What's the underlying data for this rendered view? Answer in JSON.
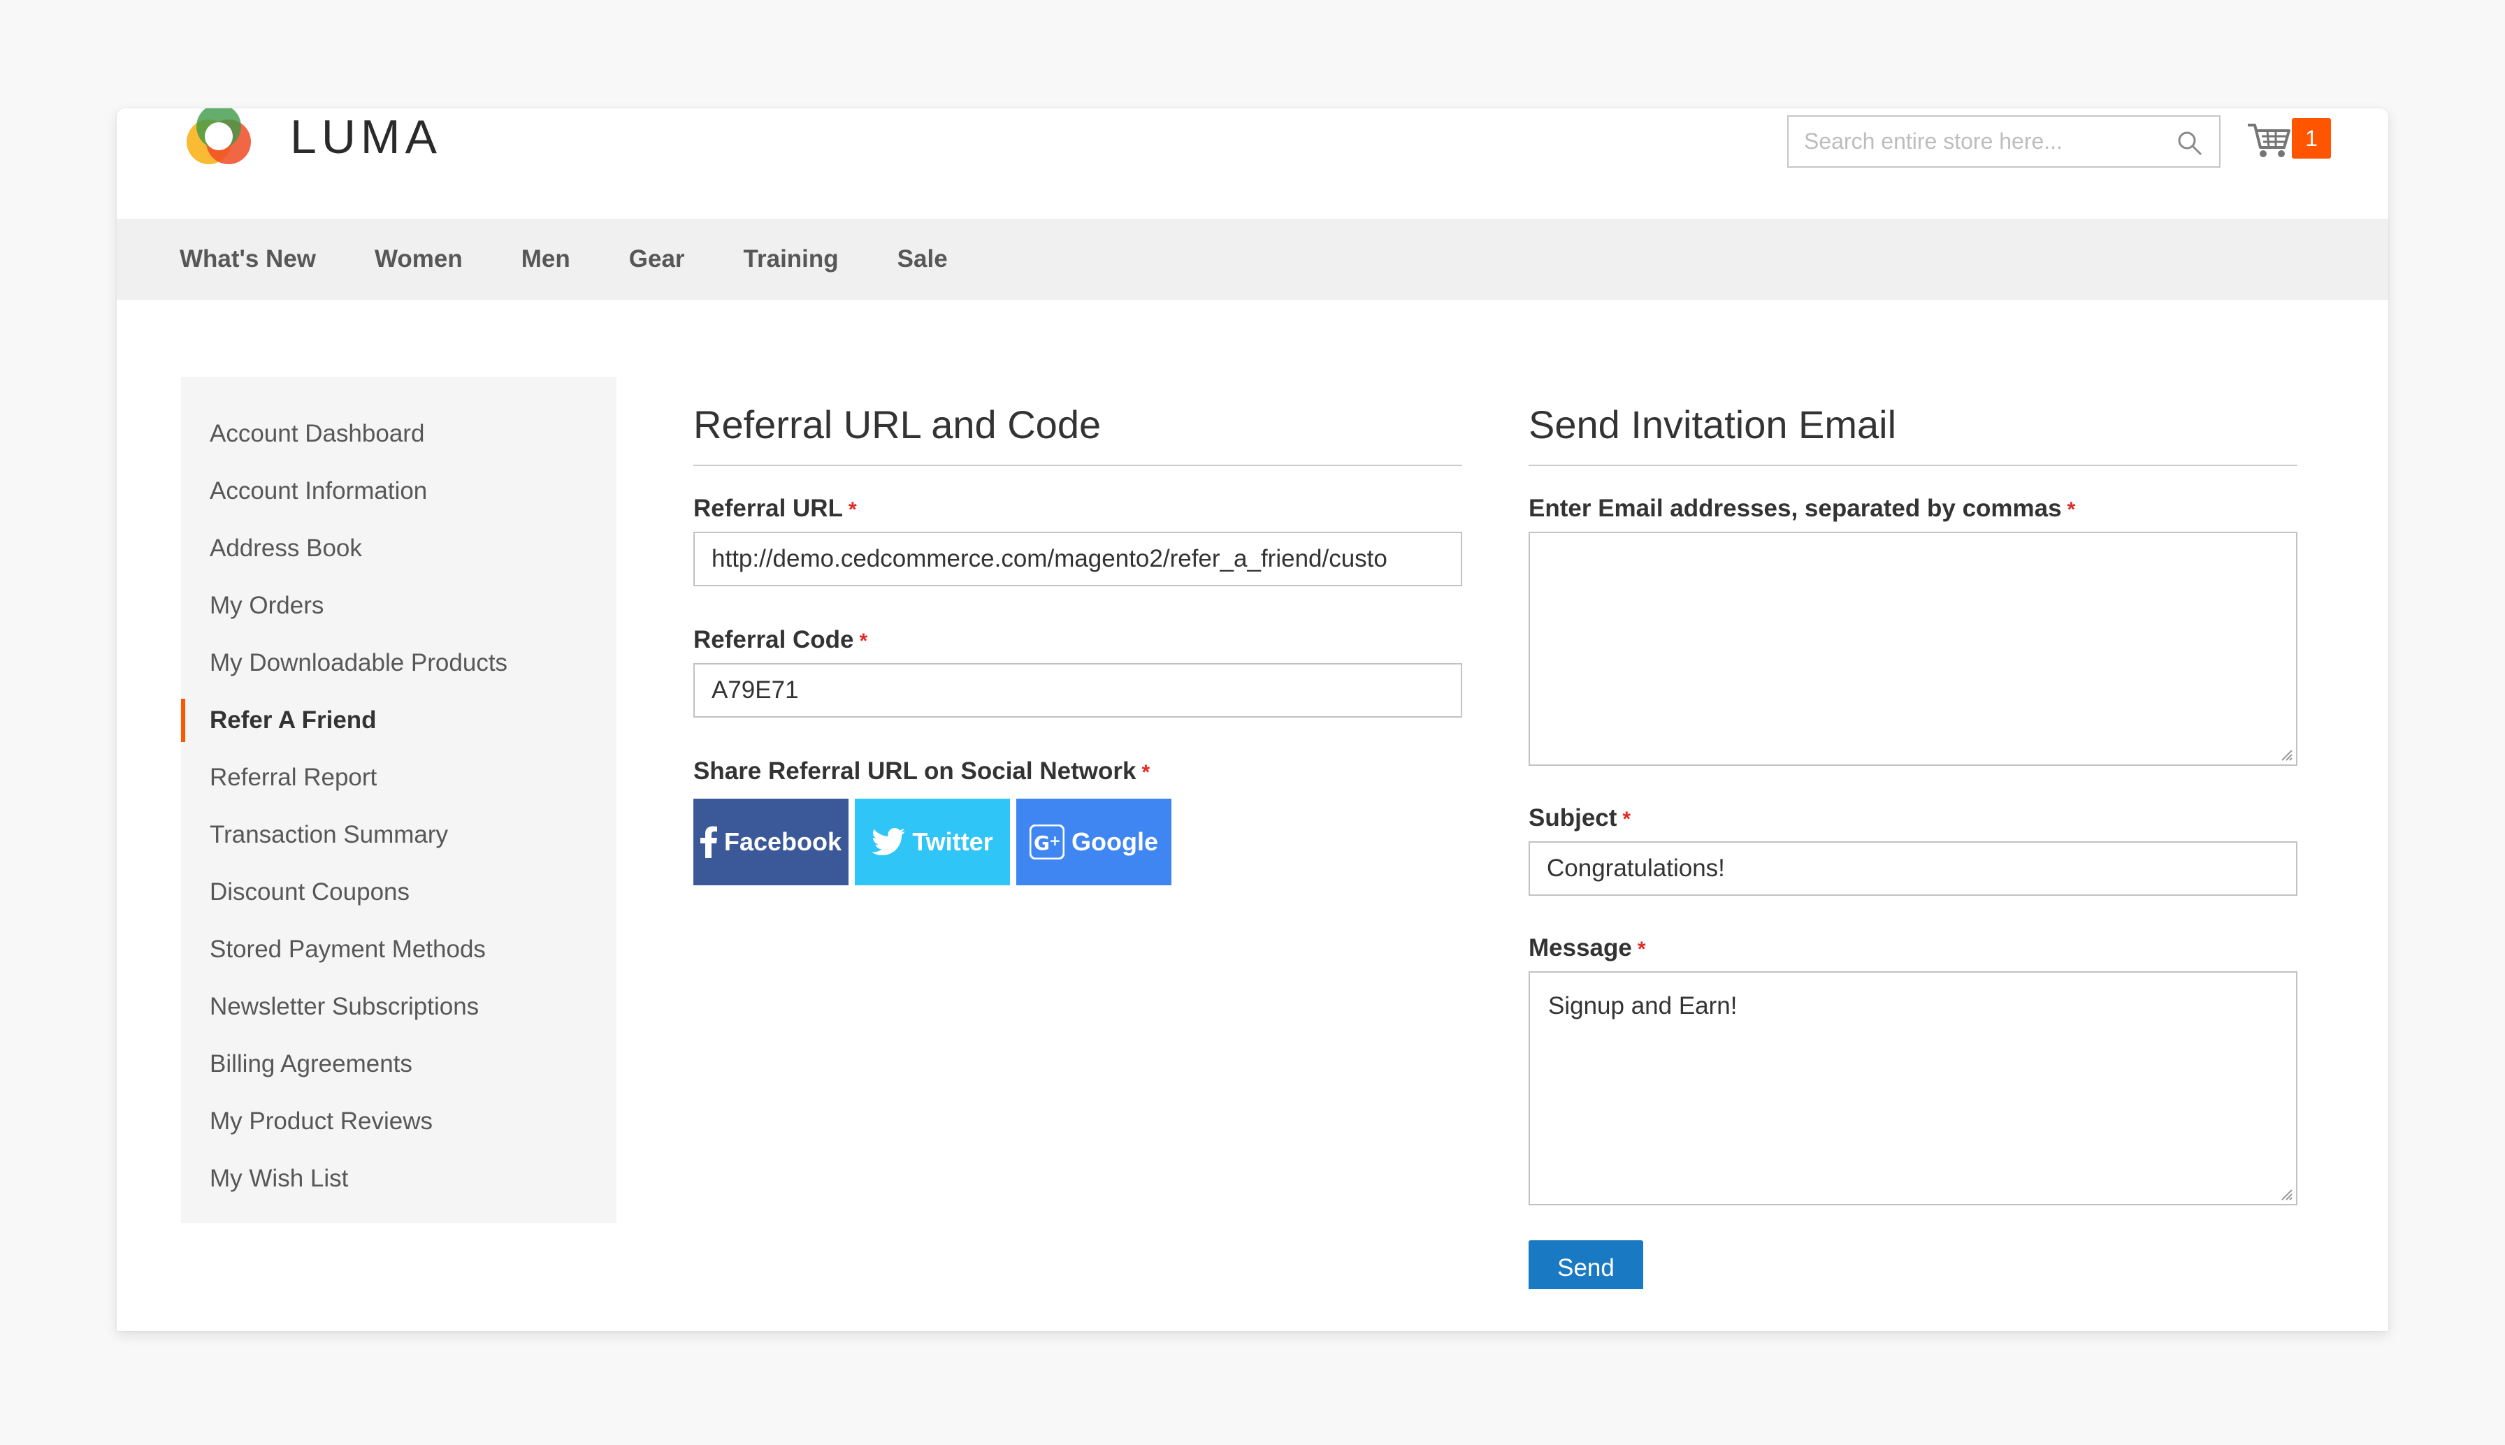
{
  "header": {
    "logo_text": "LUMA",
    "search_placeholder": "Search entire store here...",
    "cart_count": "1"
  },
  "nav": {
    "items": [
      "What's New",
      "Women",
      "Men",
      "Gear",
      "Training",
      "Sale"
    ]
  },
  "sidebar": {
    "items": [
      "Account Dashboard",
      "Account Information",
      "Address Book",
      "My Orders",
      "My Downloadable Products",
      "Refer A Friend",
      "Referral Report",
      "Transaction Summary",
      "Discount Coupons",
      "Stored Payment Methods",
      "Newsletter Subscriptions",
      "Billing Agreements",
      "My Product Reviews",
      "My Wish List"
    ],
    "active": "Refer A Friend"
  },
  "referral": {
    "heading": "Referral URL and Code",
    "url_label": "Referral URL",
    "url_value": "http://demo.cedcommerce.com/magento2/refer_a_friend/custo",
    "code_label": "Referral Code",
    "code_value": "A79E71",
    "share_label": "Share Referral URL on Social Network",
    "facebook_label": "Facebook",
    "twitter_label": "Twitter",
    "google_label": "Google"
  },
  "invite": {
    "heading": "Send Invitation Email",
    "emails_label": "Enter Email addresses, separated by commas",
    "emails_value": "",
    "subject_label": "Subject",
    "subject_value": "Congratulations!",
    "message_label": "Message",
    "message_value": "Signup and Earn!",
    "send_label": "Send"
  },
  "required_mark": "*",
  "colors": {
    "accent_orange": "#ff5501",
    "primary_blue": "#1979c3",
    "facebook": "#3b5998",
    "twitter": "#2fc6f7",
    "google": "#3f86f2",
    "required_red": "#e02b27"
  }
}
